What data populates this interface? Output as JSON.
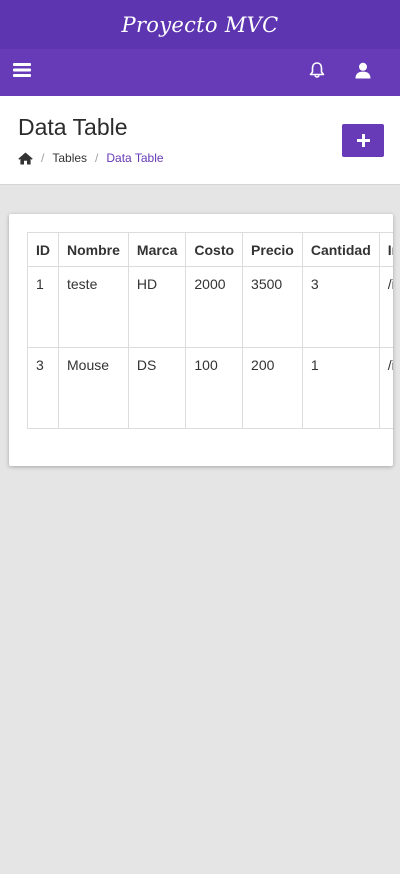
{
  "app": {
    "brand": "Proyecto MVC"
  },
  "navbar": {
    "menu_icon": "hamburger-menu-icon",
    "notifications_icon": "bell-icon",
    "user_icon": "user-icon"
  },
  "page": {
    "title": "Data Table",
    "breadcrumb": {
      "home_icon": "home-icon",
      "items": [
        "Tables",
        "Data Table"
      ]
    },
    "add_icon": "plus-icon"
  },
  "table": {
    "headers": [
      "ID",
      "Nombre",
      "Marca",
      "Costo",
      "Precio",
      "Cantidad",
      "Imagen"
    ],
    "rows": [
      [
        "1",
        "teste",
        "HD",
        "2000",
        "3500",
        "3",
        "/img/"
      ],
      [
        "3",
        "Mouse",
        "DS",
        "100",
        "200",
        "1",
        "/img/"
      ]
    ]
  },
  "colors": {
    "brand_bar": "#5e35b1",
    "navbar": "#673ab7",
    "accent": "#673ab7",
    "background": "#e5e5e5"
  }
}
